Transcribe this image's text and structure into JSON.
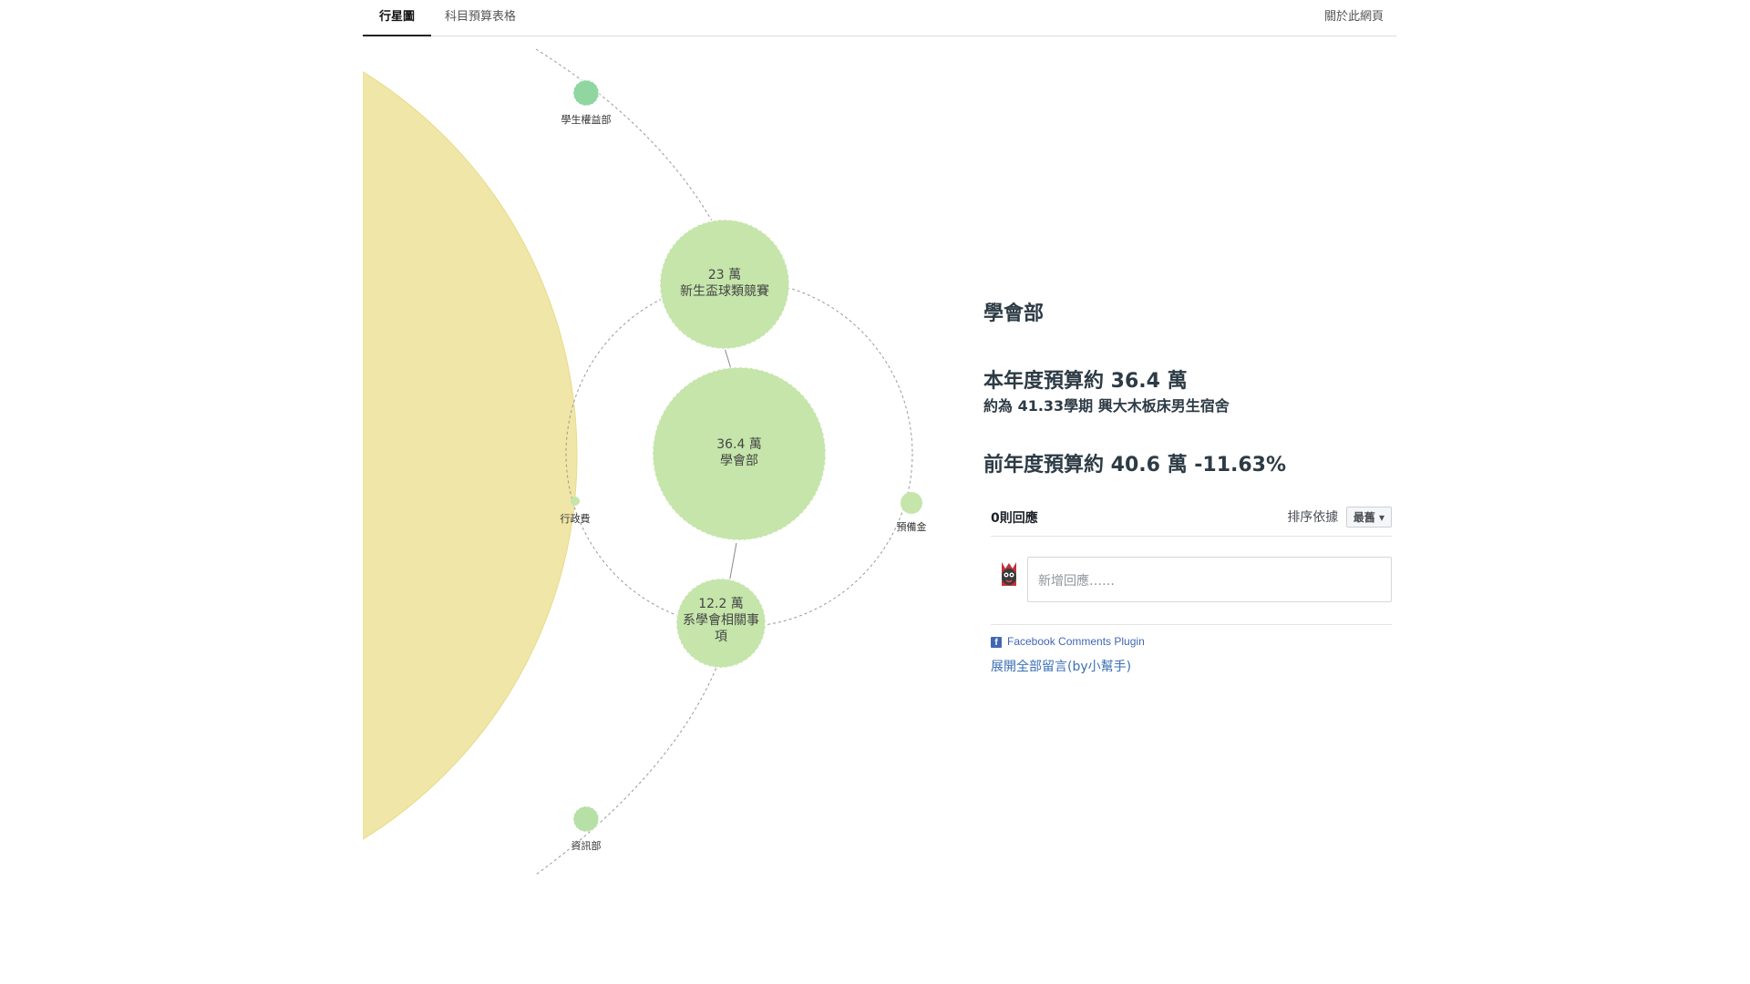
{
  "nav": {
    "tabs": [
      {
        "label": "行星圖",
        "active": true
      },
      {
        "label": "科目預算表格",
        "active": false
      }
    ],
    "about_label": "關於此網頁"
  },
  "colors": {
    "sun": "#efe6a7",
    "bubble": "#c5e5ab",
    "bubble_dark": "#8fd6a0",
    "accent_link": "#3b6fb6",
    "text_dark": "#2d3b45"
  },
  "chart": {
    "center": {
      "amount": "36.4 萬",
      "name": "學會部"
    },
    "children": [
      {
        "amount": "23 萬",
        "name": "新生盃球類競賽"
      },
      {
        "amount": "12.2 萬",
        "lines": [
          "系學會相關事",
          "項"
        ]
      },
      {
        "name": "行政費"
      },
      {
        "name": "預備金"
      }
    ],
    "siblings": [
      {
        "name": "學生權益部"
      },
      {
        "name": "資訊部"
      }
    ]
  },
  "info": {
    "title": "學會部",
    "current_budget": "本年度預算約 36.4 萬",
    "equivalent": "約為 41.33學期 興大木板床男生宿舍",
    "previous_budget": "前年度預算約 40.6 萬 -11.63%"
  },
  "comments": {
    "count": "0則回應",
    "sort_label": "排序依據",
    "sort_value": "最舊",
    "input_placeholder": "新增回應……",
    "plugin_label": "Facebook Comments Plugin",
    "expand_label": "展開全部留言(by小幫手)"
  }
}
